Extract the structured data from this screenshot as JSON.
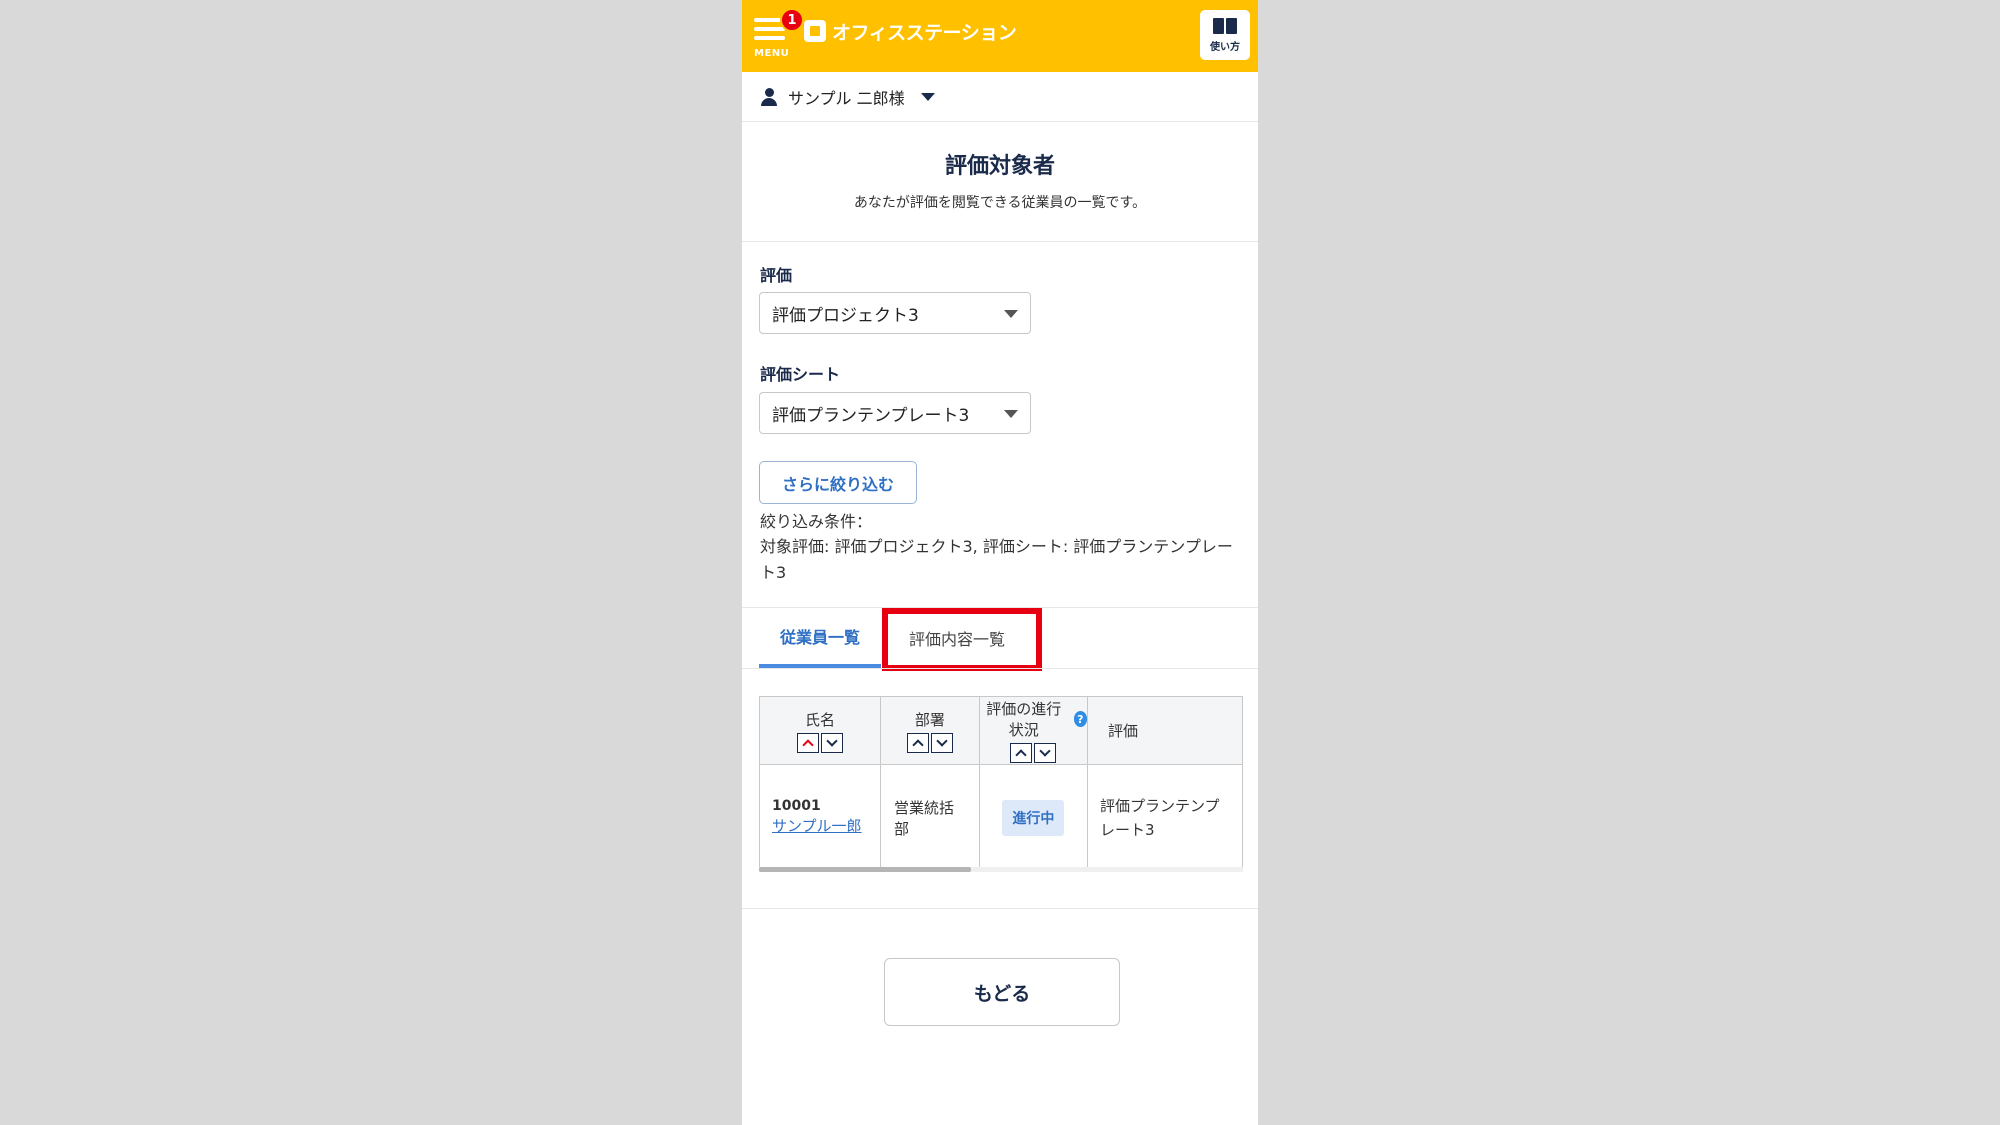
{
  "header": {
    "menu_label": "MENU",
    "menu_badge": "1",
    "logo_text": "オフィスステーション",
    "guide_label": "使い方",
    "bg_color": "#ffc000"
  },
  "user": {
    "name": "サンプル 二郎様"
  },
  "page": {
    "title": "評価対象者",
    "description": "あなたが評価を閲覧できる従業員の一覧です。"
  },
  "filters": {
    "evaluation_label": "評価",
    "evaluation_value": "評価プロジェクト3",
    "sheet_label": "評価シート",
    "sheet_value": "評価プランテンプレート3",
    "narrow_button": "さらに絞り込む",
    "condition_label": "絞り込み条件：",
    "condition_text": "対象評価: 評価プロジェクト3, 評価シート: 評価プランテンプレート3"
  },
  "tabs": [
    {
      "label": "従業員一覧",
      "active": true
    },
    {
      "label": "評価内容一覧",
      "active": false
    }
  ],
  "table": {
    "columns": [
      "氏名",
      "部署",
      "評価の進行状況",
      "評価"
    ],
    "rows": [
      {
        "id": "10001",
        "name": "サンプル一郎",
        "department": "営業統括部",
        "status": "進行中",
        "sheet": "評価プランテンプレート3"
      }
    ]
  },
  "back_button": "もどる",
  "icons": {
    "menu": "hamburger-icon",
    "guide": "book-icon",
    "user": "user-icon",
    "help": "help-icon"
  }
}
